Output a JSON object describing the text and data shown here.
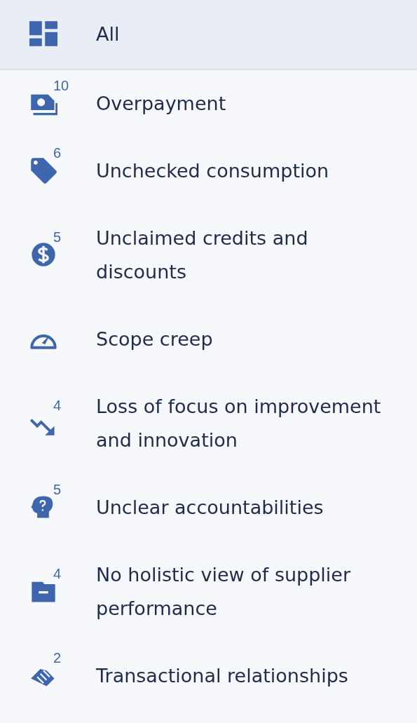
{
  "items": [
    {
      "label": "All",
      "selected": true
    },
    {
      "label": "Overpayment",
      "count": "10",
      "selected": false
    },
    {
      "label": "Unchecked consumption",
      "count": "6",
      "selected": false
    },
    {
      "label": "Unclaimed credits and discounts",
      "count": "5",
      "selected": false
    },
    {
      "label": "Scope creep",
      "selected": false
    },
    {
      "label": "Loss of focus on improvement and innovation",
      "count": "4",
      "selected": false
    },
    {
      "label": "Unclear accountabilities",
      "count": "5",
      "selected": false
    },
    {
      "label": "No holistic view of supplier performance",
      "count": "4",
      "selected": false
    },
    {
      "label": "Transactional relationships",
      "count": "2",
      "selected": false
    }
  ]
}
